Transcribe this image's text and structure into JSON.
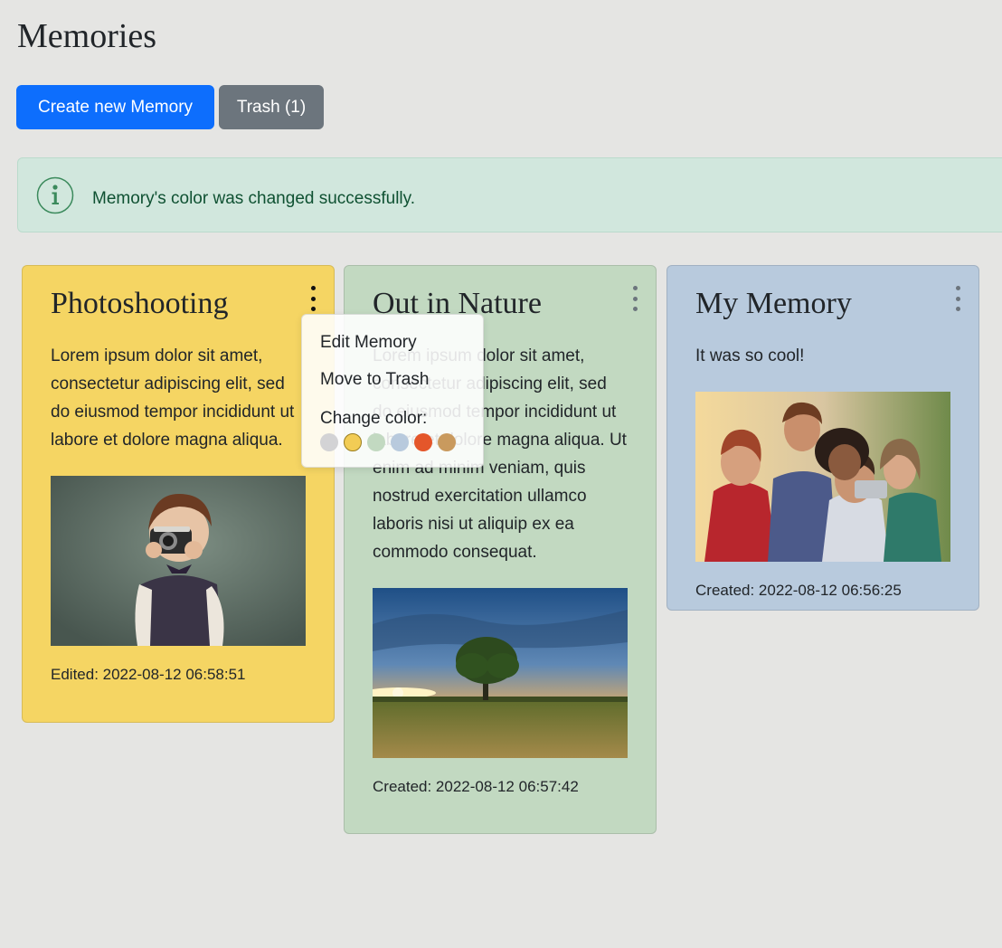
{
  "page": {
    "title": "Memories"
  },
  "toolbar": {
    "create_label": "Create new Memory",
    "trash_label": "Trash (1)"
  },
  "alert": {
    "text": "Memory's color was changed successfully.",
    "icon": "info-circle-icon"
  },
  "colors": {
    "primary": "#0d6efd",
    "secondary": "#6c757d",
    "alert_bg": "#d1e7dd",
    "alert_text": "#0f5132"
  },
  "memories": [
    {
      "title": "Photoshooting",
      "text": "Lorem ipsum dolor sit amet, consectetur adipiscing elit, sed do eiusmod tempor incididunt ut labore et dolore magna aliqua.",
      "meta": "Edited: 2022-08-12 06:58:51",
      "color": "#f5d563",
      "image": "child-with-camera-photo"
    },
    {
      "title": "Out in Nature",
      "text": "Lorem ipsum dolor sit amet, consectetur adipiscing elit, sed do eiusmod tempor incididunt ut labore et dolore magna aliqua. Ut enim ad minim veniam, quis nostrud exercitation ullamco laboris nisi ut aliquip ex ea commodo consequat.",
      "meta": "Created: 2022-08-12 06:57:42",
      "color": "#c2d9c1",
      "image": "tree-at-sunset-photo"
    },
    {
      "title": "My Memory",
      "text": "It was so cool!",
      "meta": "Created: 2022-08-12 06:56:25",
      "color": "#b8cadd",
      "image": "friends-selfie-photo"
    }
  ],
  "menu": {
    "edit_label": "Edit Memory",
    "trash_label": "Move to Trash",
    "color_label": "Change color:",
    "swatches": [
      "#d3d3d5",
      "#f2cc55",
      "#c2d9c1",
      "#b8cadd",
      "#e4562a",
      "#c99a5e"
    ],
    "selected_swatch": 1
  }
}
